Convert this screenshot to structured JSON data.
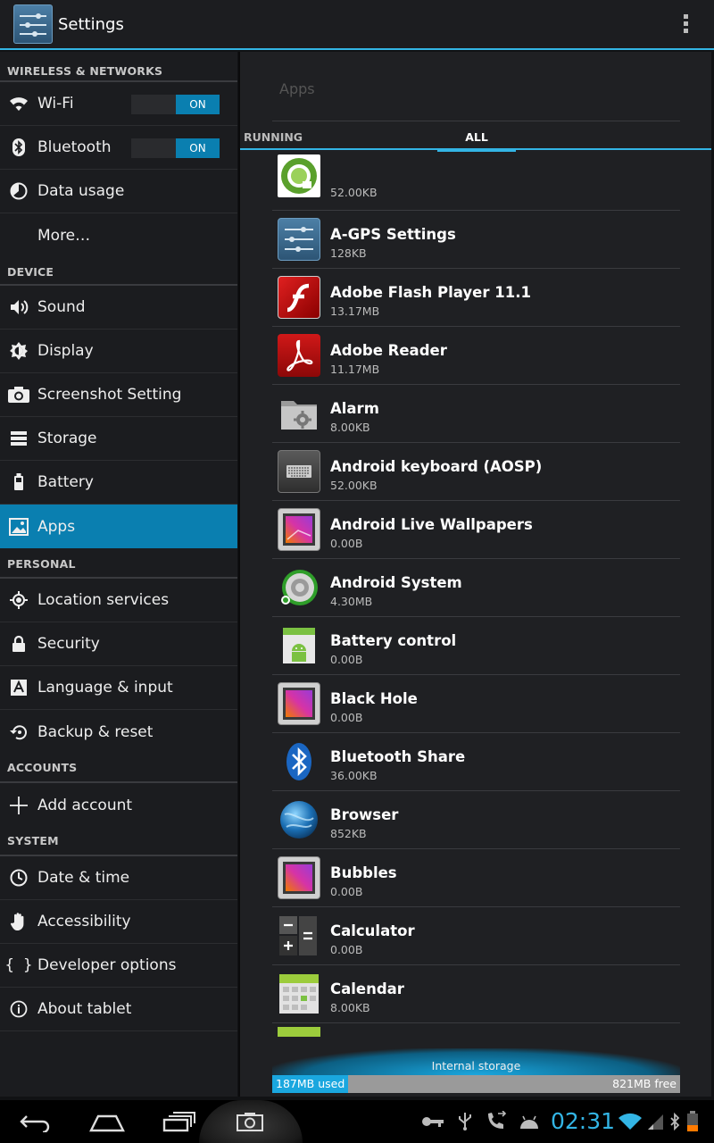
{
  "actionbar": {
    "title": "Settings"
  },
  "sidebar": {
    "wireless": {
      "header": "WIRELESS & NETWORKS",
      "wifi": {
        "label": "Wi-Fi",
        "toggle": "ON"
      },
      "bluetooth": {
        "label": "Bluetooth",
        "toggle": "ON"
      },
      "data_usage": "Data usage",
      "more": "More…"
    },
    "device": {
      "header": "DEVICE",
      "sound": "Sound",
      "display": "Display",
      "screenshot": "Screenshot Setting",
      "storage": "Storage",
      "battery": "Battery",
      "apps": "Apps"
    },
    "personal": {
      "header": "PERSONAL",
      "location": "Location services",
      "security": "Security",
      "language": "Language & input",
      "backup": "Backup & reset"
    },
    "accounts": {
      "header": "ACCOUNTS",
      "add": "Add account"
    },
    "system": {
      "header": "SYSTEM",
      "datetime": "Date & time",
      "accessibility": "Accessibility",
      "developer": "Developer options",
      "about": "About tablet"
    }
  },
  "main": {
    "title": "Apps",
    "tabs": {
      "running": "RUNNING",
      "all": "ALL"
    },
    "apps": [
      {
        "name": "",
        "size": "52.00KB",
        "icon": "green-circle-app-icon"
      },
      {
        "name": "A-GPS Settings",
        "size": "128KB",
        "icon": "settings-sliders-icon"
      },
      {
        "name": "Adobe Flash Player 11.1",
        "size": "13.17MB",
        "icon": "flash-player-icon"
      },
      {
        "name": "Adobe Reader",
        "size": "11.17MB",
        "icon": "adobe-reader-icon"
      },
      {
        "name": "Alarm",
        "size": "8.00KB",
        "icon": "folder-gear-icon"
      },
      {
        "name": "Android keyboard (AOSP)",
        "size": "52.00KB",
        "icon": "keyboard-icon"
      },
      {
        "name": "Android Live Wallpapers",
        "size": "0.00B",
        "icon": "wallpaper-icon"
      },
      {
        "name": "Android System",
        "size": "4.30MB",
        "icon": "android-system-icon"
      },
      {
        "name": "Battery control",
        "size": "0.00B",
        "icon": "android-robot-icon"
      },
      {
        "name": "Black Hole",
        "size": "0.00B",
        "icon": "wallpaper-icon"
      },
      {
        "name": "Bluetooth Share",
        "size": "36.00KB",
        "icon": "bluetooth-share-icon"
      },
      {
        "name": "Browser",
        "size": "852KB",
        "icon": "globe-icon"
      },
      {
        "name": "Bubbles",
        "size": "0.00B",
        "icon": "wallpaper-icon"
      },
      {
        "name": "Calculator",
        "size": "0.00B",
        "icon": "calculator-icon"
      },
      {
        "name": "Calendar",
        "size": "8.00KB",
        "icon": "calendar-icon"
      },
      {
        "name": "",
        "size": "",
        "icon": "partial-app-icon"
      }
    ],
    "storage": {
      "label": "Internal storage",
      "used": "187MB used",
      "free": "821MB free",
      "used_fraction": 0.185
    }
  },
  "navbar": {
    "clock": "02:31"
  },
  "colors": {
    "accent": "#33b5e5",
    "selected": "#0a7fb0"
  }
}
